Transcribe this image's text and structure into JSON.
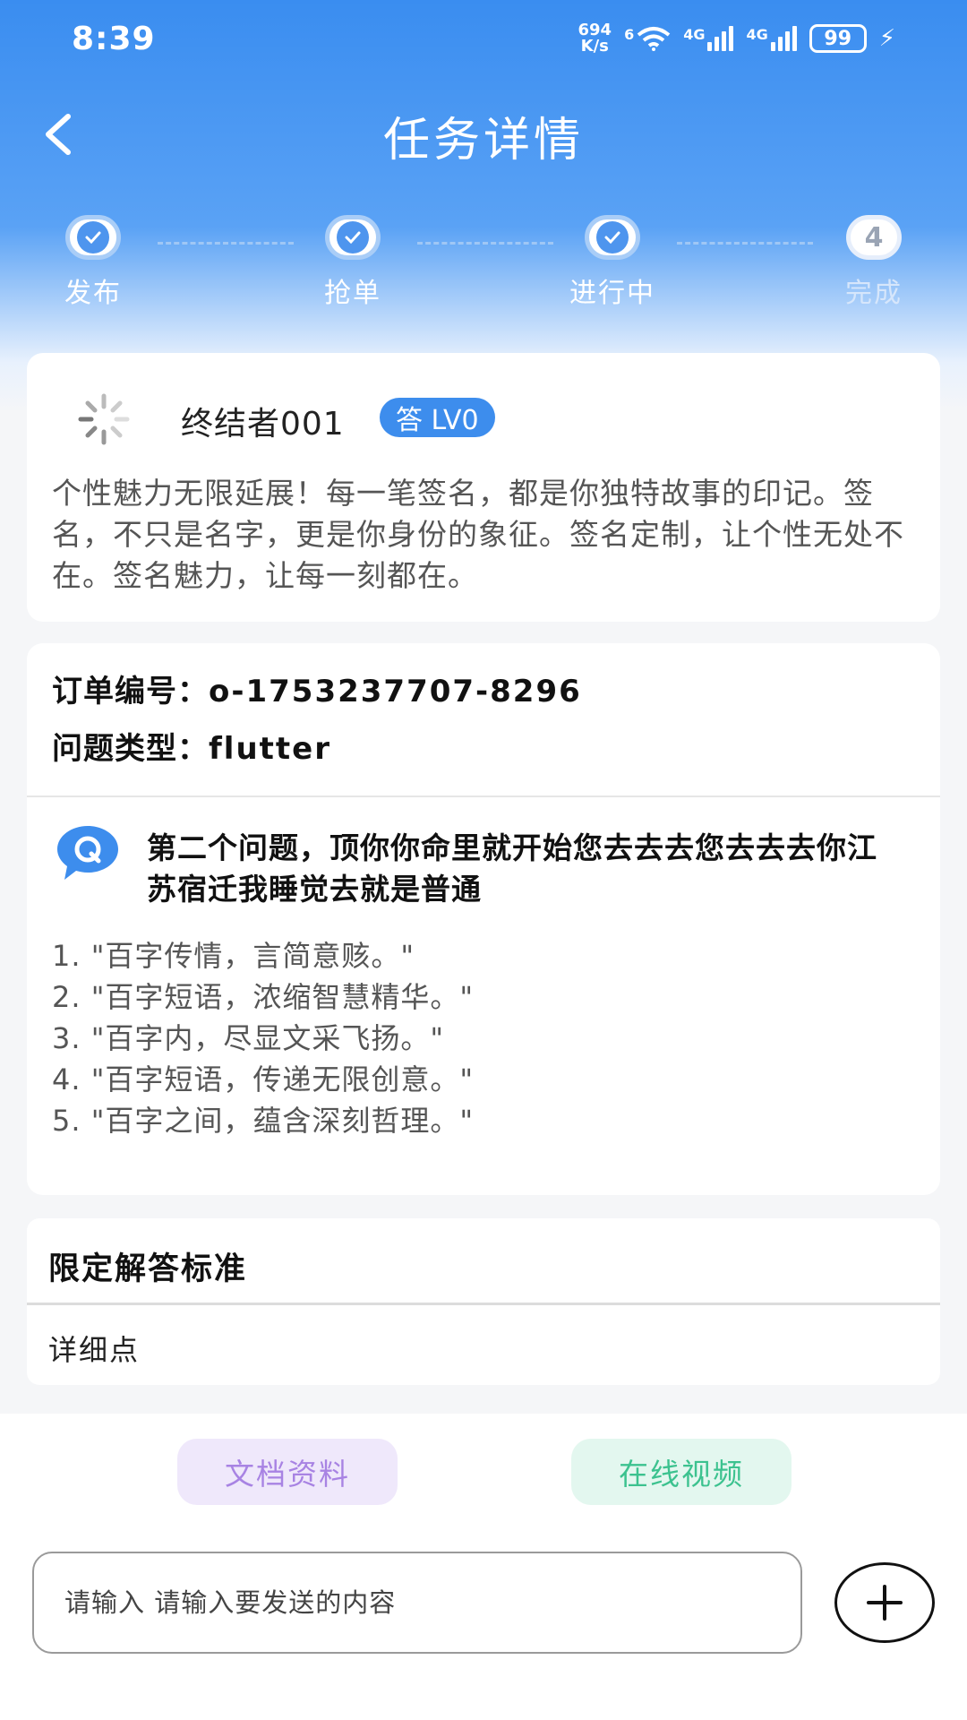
{
  "status_bar": {
    "time": "8:39",
    "net_speed_value": "694",
    "net_speed_unit": "K/s",
    "wifi_sup": "6",
    "sim1": "4G",
    "sim2": "4G",
    "battery": "99"
  },
  "header": {
    "title": "任务详情"
  },
  "steps": [
    {
      "label": "发布",
      "state": "done"
    },
    {
      "label": "抢单",
      "state": "done"
    },
    {
      "label": "进行中",
      "state": "done"
    },
    {
      "label": "完成",
      "state": "pending",
      "number": "4"
    }
  ],
  "author": {
    "name": "终结者001",
    "badge": "答 LV0",
    "description": "个性魅力无限延展！每一笔签名，都是你独特故事的印记。签名，不只是名字，更是你身份的象征。签名定制，让个性无处不在。签名魅力，让每一刻都在。"
  },
  "order": {
    "number_label": "订单编号：",
    "number_value": "o-1753237707-8296",
    "type_label": "问题类型：",
    "type_value": "flutter"
  },
  "question": {
    "title": "第二个问题，顶你你命里就开始您去去去您去去去你江苏宿迁我睡觉去就是普通",
    "answers": [
      "1. \"百字传情，言简意赅。\"",
      "2. \"百字短语，浓缩智慧精华。\"",
      "3. \"百字内，尽显文采飞扬。\"",
      "4. \"百字短语，传递无限创意。\"",
      "5. \"百字之间，蕴含深刻哲理。\""
    ]
  },
  "standard": {
    "title": "限定解答标准",
    "detail": "详细点"
  },
  "bottom": {
    "doc_button": "文档资料",
    "video_button": "在线视频",
    "input_placeholder": "请输入 请输入要发送的内容"
  },
  "colors": {
    "primary": "#3a8df0",
    "doc_pill_bg": "#efe8fb",
    "doc_pill_text": "#a883e3",
    "video_pill_bg": "#e3f7ef",
    "video_pill_text": "#3cc28f"
  }
}
